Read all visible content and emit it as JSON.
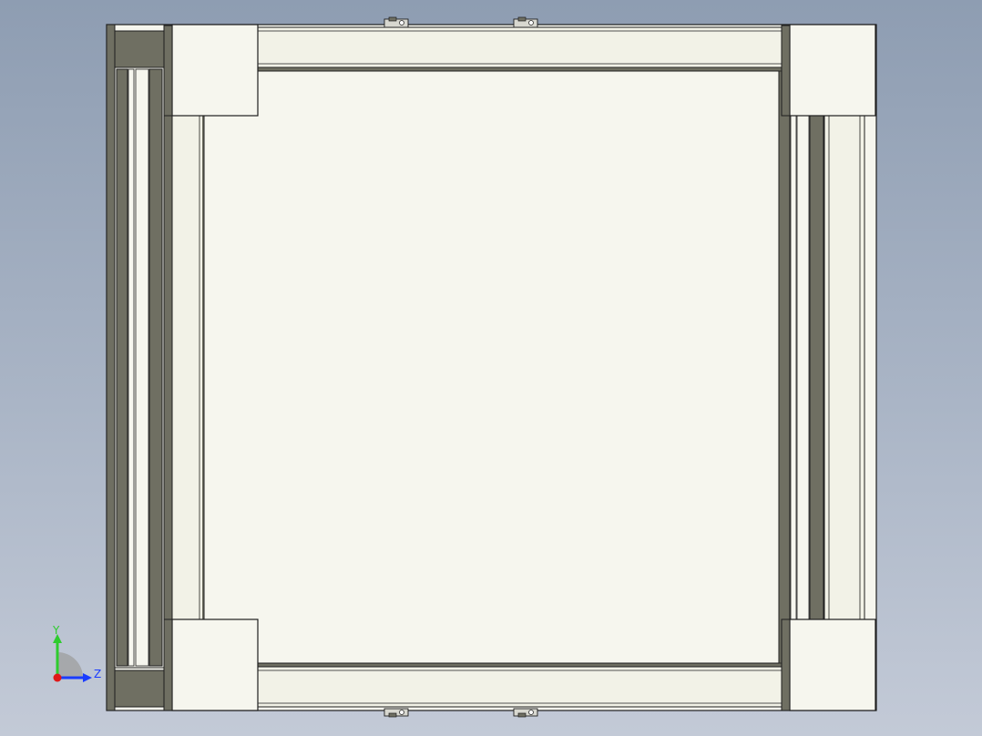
{
  "viewport": {
    "background_top": "#8e9db2",
    "background_bottom": "#c3cad7"
  },
  "model": {
    "colors": {
      "panel": "#f6f6ee",
      "extrusion": "#f2f2e7",
      "dark_metal": "#6f6f62",
      "darker_metal": "#55554a",
      "edge": "#1e1e1e",
      "bracket": "#d8d8d0"
    }
  },
  "triad": {
    "y_label": "Y",
    "z_label": "Z",
    "y_color": "#2ecc2e",
    "z_color": "#1a3cff",
    "origin_color": "#e01818"
  }
}
